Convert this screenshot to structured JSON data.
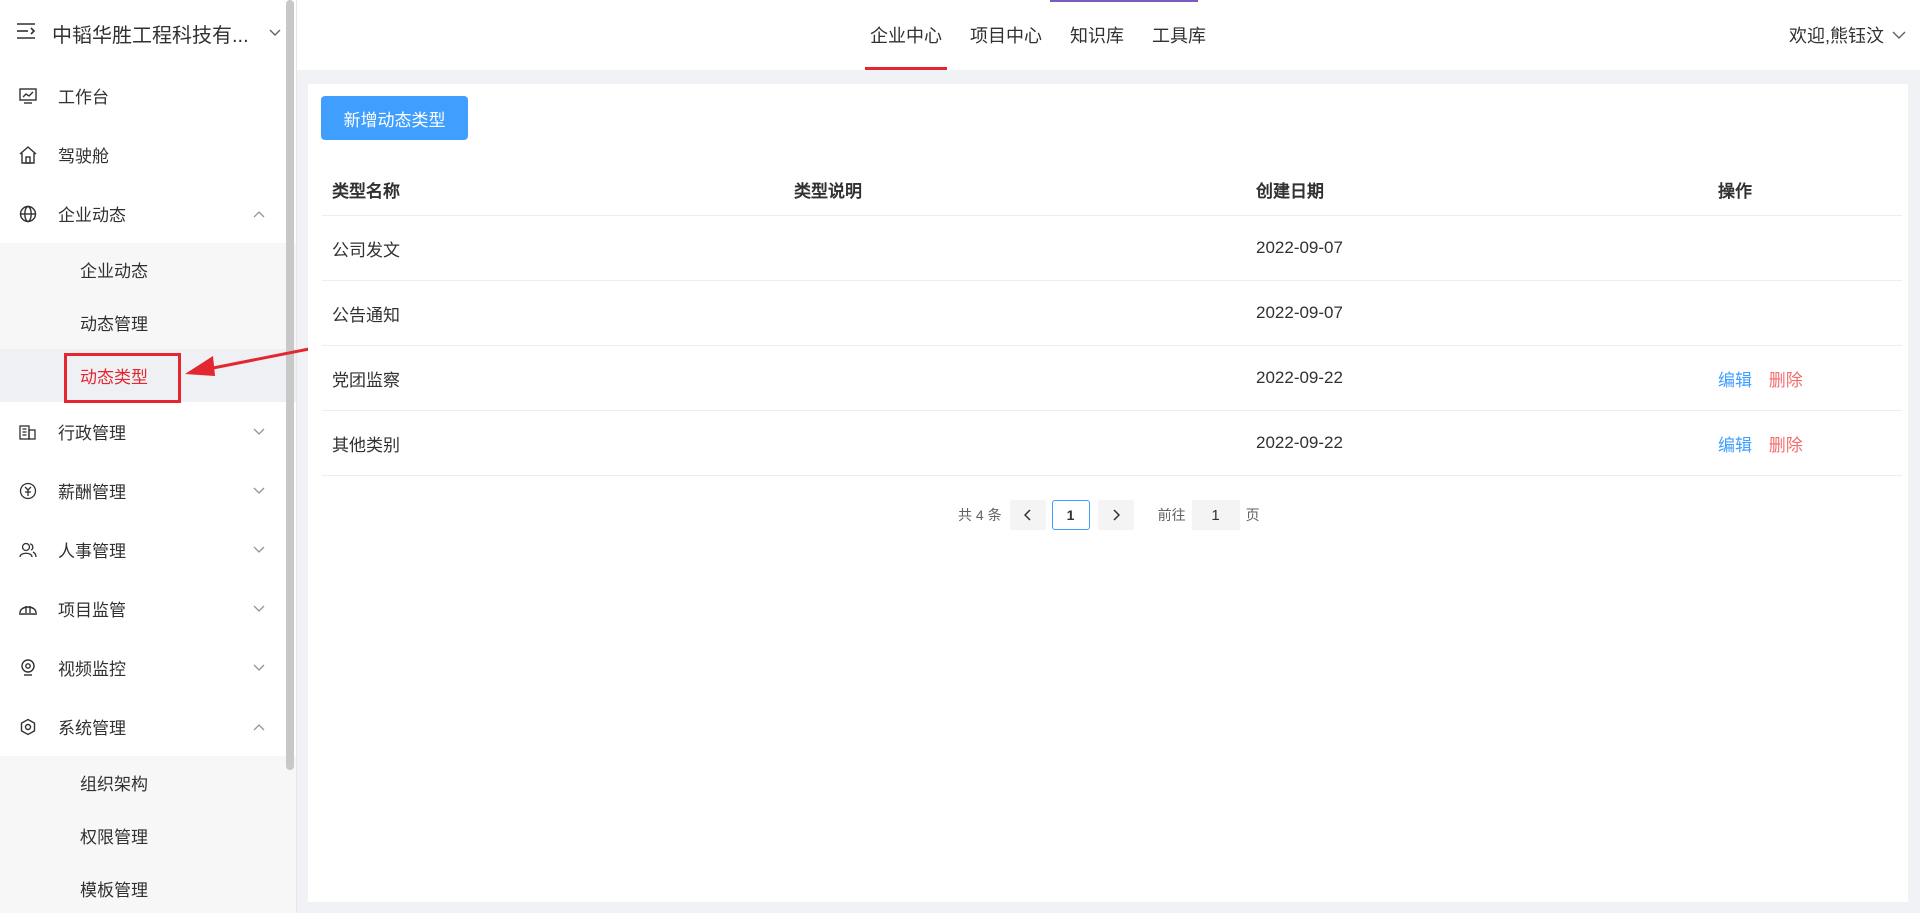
{
  "sidebar": {
    "title": "中韬华胜工程科技有...",
    "items": [
      {
        "label": "工作台"
      },
      {
        "label": "驾驶舱"
      },
      {
        "label": "企业动态",
        "sub": [
          "企业动态",
          "动态管理",
          "动态类型"
        ]
      },
      {
        "label": "行政管理"
      },
      {
        "label": "薪酬管理"
      },
      {
        "label": "人事管理"
      },
      {
        "label": "项目监管"
      },
      {
        "label": "视频监控"
      },
      {
        "label": "系统管理",
        "sub": [
          "组织架构",
          "权限管理",
          "模板管理"
        ]
      }
    ]
  },
  "topnav": {
    "tabs": [
      "企业中心",
      "项目中心",
      "知识库",
      "工具库"
    ],
    "user": "欢迎,熊钰汶"
  },
  "main": {
    "add_button": "新增动态类型",
    "table": {
      "headers": [
        "类型名称",
        "类型说明",
        "创建日期",
        "操作"
      ],
      "rows": [
        {
          "name": "公司发文",
          "desc": "",
          "date": "2022-09-07"
        },
        {
          "name": "公告通知",
          "desc": "",
          "date": "2022-09-07"
        },
        {
          "name": "党团监察",
          "desc": "",
          "date": "2022-09-22"
        },
        {
          "name": "其他类别",
          "desc": "",
          "date": "2022-09-22"
        }
      ],
      "edit_label": "编辑",
      "delete_label": "删除"
    },
    "pagination": {
      "total": "共 4 条",
      "current": "1",
      "goto_label": "前往",
      "goto_value": "1",
      "page_suffix": "页"
    }
  },
  "colors": {
    "accent": "#409eff",
    "active_red": "#e3262f",
    "danger": "#f56c6c"
  }
}
